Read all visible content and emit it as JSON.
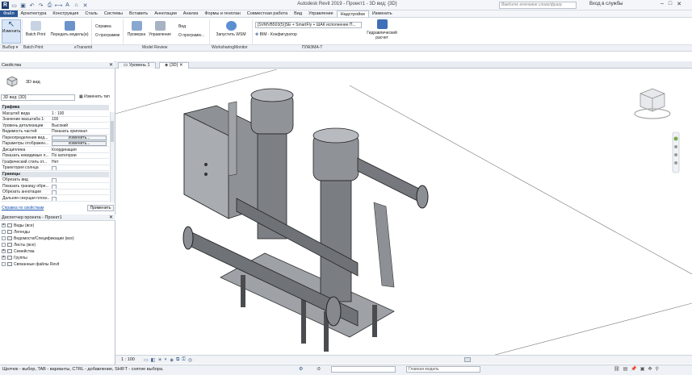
{
  "window": {
    "title": "Autodesk Revit 2019 - Проект1 - 3D вид: {3D}",
    "search_placeholder": "Введите ключевое слово/фразу",
    "sign_in": "Вход в службы",
    "controls": [
      "–",
      "□",
      "✕"
    ]
  },
  "ribbon_tabs": [
    "Файл",
    "Архитектура",
    "Конструкция",
    "Сталь",
    "Системы",
    "Вставить",
    "Аннотации",
    "Анализ",
    "Формы и генплан",
    "Совместная работа",
    "Вид",
    "Управление",
    "Надстройки",
    "Изменить"
  ],
  "ribbon": {
    "modify": "Изменить",
    "batch_print": "Batch Print",
    "transmit": "Передать модель(и)",
    "help": "Справка",
    "about": "О программе",
    "check": "Проверка",
    "manage": "Управление",
    "view": "Вид",
    "about2": "О программ...",
    "run_wsm": "Запустить WSM",
    "smartfly": "[SVMVB503(5)]SE + SmartFly + ШАК исполнение П...",
    "bim_config": "BIM - Конфигуратор",
    "hydraulic": "Гидравлический расчет"
  },
  "panels": [
    "Выбор ▾",
    "Batch Print",
    "eTransmit",
    "Model Review",
    "WorksharingMonitor",
    "ПЛАЗМА-Т"
  ],
  "properties": {
    "header": "Свойства",
    "type_label": "3D вид",
    "view_select": "3D вид: {3D}",
    "edit_type": "Изменить тип",
    "rows": [
      {
        "n": "Графика",
        "v": "",
        "group": true
      },
      {
        "n": "Масштаб вида",
        "v": "1 : 100"
      },
      {
        "n": "Значение масштаба    1:",
        "v": "100"
      },
      {
        "n": "Уровень детализации",
        "v": "Высокий"
      },
      {
        "n": "Видимость частей",
        "v": "Показать оригинал"
      },
      {
        "n": "Переопределения вид...",
        "v": "Изменить...",
        "btn": true
      },
      {
        "n": "Параметры отображен...",
        "v": "Изменить...",
        "btn": true
      },
      {
        "n": "Дисциплина",
        "v": "Координация"
      },
      {
        "n": "Показать невидимые л...",
        "v": "По категории"
      },
      {
        "n": "Графический стиль от...",
        "v": "Нет"
      },
      {
        "n": "Траектория солнца",
        "v": "",
        "chk": true
      },
      {
        "n": "Границы",
        "v": "",
        "group": true
      },
      {
        "n": "Обрезать вид",
        "v": "",
        "chk": true
      },
      {
        "n": "Показать границу обре...",
        "v": "",
        "chk": true
      },
      {
        "n": "Обрезать аннотации",
        "v": "",
        "chk": true
      },
      {
        "n": "Дальняя секущая плоск...",
        "v": "",
        "chk": true
      }
    ],
    "help_link": "Справка по свойствам",
    "apply": "Применить"
  },
  "browser": {
    "header": "Диспетчер проекта - Проект1",
    "items": [
      {
        "label": "Виды (все)",
        "sign": "+"
      },
      {
        "label": "Легенды",
        "sign": ""
      },
      {
        "label": "Ведомости/Спецификации (все)",
        "sign": ""
      },
      {
        "label": "Листы (все)",
        "sign": ""
      },
      {
        "label": "Семейства",
        "sign": "+"
      },
      {
        "label": "Группы",
        "sign": "+"
      },
      {
        "label": "Связанные файлы Revit",
        "sign": ""
      }
    ]
  },
  "view_tabs": [
    "Уровень 1",
    "{3D}"
  ],
  "view_bar": {
    "scale": "1 : 100"
  },
  "status": {
    "hint": "Щелчок - выбор, TAB - варианты, CTRL - добавление, SHIFT - снятие выбора.",
    "zero": ":0",
    "model": "Главная модель"
  },
  "colors": {
    "accent": "#2b5797",
    "link": "#1a56b5",
    "equipment": "#8a8d92"
  }
}
